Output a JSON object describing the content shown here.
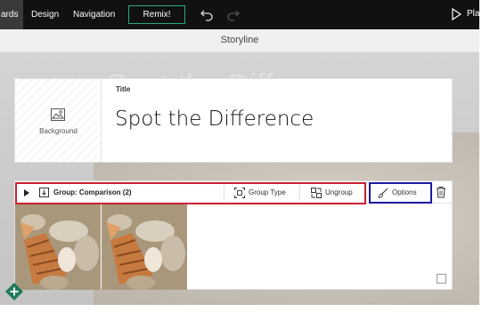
{
  "nav": {
    "cards_label": "ards",
    "design_label": "Design",
    "navigation_label": "Navigation",
    "remix_label": "Remix!",
    "play_label": "Play"
  },
  "storyline": {
    "title": "Storyline"
  },
  "background_ghost": "Spot the Diffe",
  "title_card": {
    "background_label": "Background",
    "field_label": "Title",
    "title_text": "Spot the Difference"
  },
  "group_toolbar": {
    "group_label": "Group: Comparison (2)",
    "group_type_label": "Group Type",
    "ungroup_label": "Ungroup",
    "options_label": "Options"
  },
  "colors": {
    "topbar": "#111111",
    "remix_border": "#2aa886",
    "highlight_red": "#cc1f2f",
    "highlight_blue": "#1a1aa6",
    "add_button": "#1f7a5a"
  },
  "icons": [
    "undo-icon",
    "redo-icon",
    "play-icon",
    "image-icon",
    "expand-arrow-icon",
    "group-icon",
    "group-type-icon",
    "ungroup-icon",
    "brush-icon",
    "trash-icon",
    "plus-icon"
  ]
}
